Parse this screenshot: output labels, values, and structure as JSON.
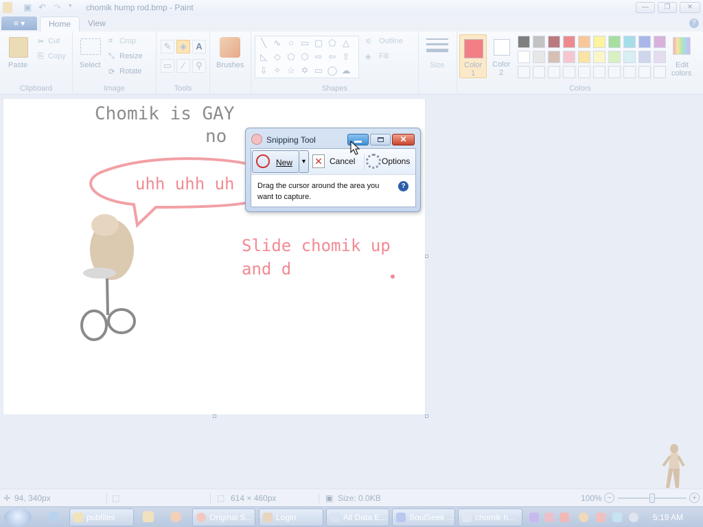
{
  "window": {
    "title": "chomik hump rod.bmp - Paint",
    "min_glyph": "—",
    "max_glyph": "❐",
    "close_glyph": "✕"
  },
  "ribbon_tabs": {
    "file_glyph": "≡ ▾",
    "home": "Home",
    "view": "View",
    "help_glyph": "?"
  },
  "clipboard": {
    "paste": "Paste",
    "cut": "Cut",
    "copy": "Copy",
    "label": "Clipboard"
  },
  "image": {
    "select": "Select",
    "crop": "Crop",
    "resize": "Resize",
    "rotate": "Rotate",
    "label": "Image"
  },
  "tools": {
    "label": "Tools",
    "text_glyph": "A"
  },
  "brushes": {
    "label": "Brushes"
  },
  "shapes": {
    "label": "Shapes",
    "outline": "Outline",
    "fill": "Fill"
  },
  "size": {
    "label": "Size"
  },
  "colors": {
    "color1_label": "Color",
    "color1_num": "1",
    "color2_label": "Color",
    "color2_num": "2",
    "edit_label": "Edit",
    "edit_label2": "colors",
    "group_label": "Colors",
    "color1_value": "#f27e86",
    "color2_value": "#ffffff",
    "palette_row1": [
      "#7f7f7f",
      "#c3c3c3",
      "#b97a7f",
      "#ed8a8f",
      "#f9c79a",
      "#fdf29e",
      "#a8dfa0",
      "#a5dde9",
      "#a9b6e9",
      "#d8b2dc"
    ],
    "palette_row2": [
      "#ffffff",
      "#e7e7e7",
      "#d6c0b3",
      "#f5c6cf",
      "#fbe3a6",
      "#fbf6c8",
      "#d9f0c2",
      "#d7eef2",
      "#cfd6ec",
      "#e6dcef"
    ]
  },
  "canvas": {
    "line1": "Chomik is GAY",
    "line2": "no",
    "bubble_text": "uhh uhh uh",
    "slide1": "Slide chomik up",
    "slide2": "and d"
  },
  "snipping_tool": {
    "title": "Snipping Tool",
    "new": "New",
    "cancel": "Cancel",
    "options": "Options",
    "message": "Drag the cursor around the area you want to capture."
  },
  "status": {
    "position": "94, 340px",
    "size": "614 × 460px",
    "file_size": "Size: 0.0KB",
    "zoom": "100%"
  },
  "taskbar": {
    "items": [
      "pubfiles",
      "Original S...",
      "Login",
      "All Data E...",
      "SoulSeek ...",
      "chomik h..."
    ],
    "clock": "5:19 AM"
  }
}
